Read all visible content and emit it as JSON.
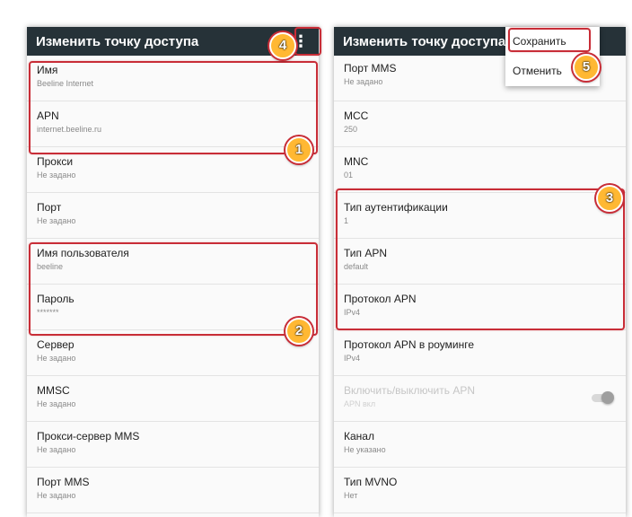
{
  "left_screen": {
    "title": "Изменить точку доступа",
    "overflow_glyph": "⋮",
    "items": [
      {
        "title": "Имя",
        "value": "Beeline Internet"
      },
      {
        "title": "APN",
        "value": "internet.beeline.ru"
      },
      {
        "title": "Прокси",
        "value": "Не задано"
      },
      {
        "title": "Порт",
        "value": "Не задано"
      },
      {
        "title": "Имя пользователя",
        "value": "beeline"
      },
      {
        "title": "Пароль",
        "value": "*******"
      },
      {
        "title": "Сервер",
        "value": "Не задано"
      },
      {
        "title": "MMSC",
        "value": "Не задано"
      },
      {
        "title": "Прокси-сервер MMS",
        "value": "Не задано"
      },
      {
        "title": "Порт MMS",
        "value": "Не задано"
      }
    ]
  },
  "right_screen": {
    "title": "Изменить точку доступа",
    "items": [
      {
        "title": "Порт MMS",
        "value": "Не задано"
      },
      {
        "title": "MCC",
        "value": "250"
      },
      {
        "title": "MNC",
        "value": "01"
      },
      {
        "title": "Тип аутентификации",
        "value": "1"
      },
      {
        "title": "Тип APN",
        "value": "default"
      },
      {
        "title": "Протокол APN",
        "value": "IPv4"
      },
      {
        "title": "Протокол APN в роуминге",
        "value": "IPv4"
      },
      {
        "title": "Включить/выключить APN",
        "value": "APN вкл"
      },
      {
        "title": "Канал",
        "value": "Не указано"
      },
      {
        "title": "Тип MVNO",
        "value": "Нет"
      }
    ]
  },
  "menu": {
    "save_label": "Сохранить",
    "cancel_label": "Отменить"
  },
  "badges": [
    "1",
    "2",
    "3",
    "4",
    "5"
  ],
  "colors": {
    "toolbar": "#263238",
    "highlight": "#c82d37",
    "badge": "#ffb833"
  }
}
